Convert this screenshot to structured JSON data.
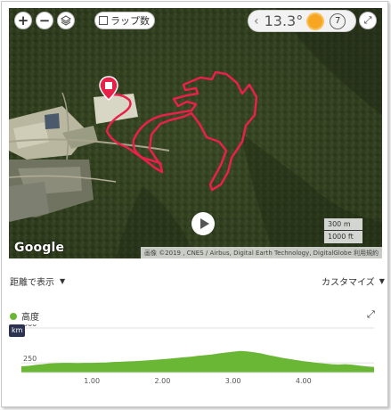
{
  "map": {
    "zoom_in": "+",
    "zoom_out": "−",
    "layers_icon": "layers-icon",
    "lap_label": "ラップ数",
    "weather": {
      "temperature": "13.3°",
      "wind": "7",
      "sun_color": "#f6a623"
    },
    "scale": {
      "metric": "300 m",
      "imperial": "1000 ft"
    },
    "google_logo": "Google",
    "attribution": "画像 ©2019 , CNES / Airbus, Digital Earth Technology, DigitalGlobe",
    "terms": "利用規約",
    "route_color": "#e8214a"
  },
  "controls": {
    "display_mode": "距離で表示",
    "customize": "カスタマイズ"
  },
  "chart_data": {
    "type": "area",
    "series": [
      {
        "name": "高度",
        "color": "#6ab735",
        "x": [
          0,
          0.1,
          0.2,
          0.3,
          0.4,
          0.5,
          0.6,
          0.7,
          0.8,
          0.9,
          1.0,
          1.1,
          1.2,
          1.3,
          1.4,
          1.5,
          1.6,
          1.7,
          1.8,
          1.9,
          2.0,
          2.1,
          2.2,
          2.3,
          2.4,
          2.5,
          2.6,
          2.7,
          2.8,
          2.9,
          3.0,
          3.1,
          3.2,
          3.3,
          3.4,
          3.5,
          3.6,
          3.7,
          3.8,
          3.9,
          4.0,
          4.1,
          4.2,
          4.3,
          4.4,
          4.5,
          4.6,
          4.7,
          4.8,
          4.9,
          5.0
        ],
        "y": [
          225,
          228,
          235,
          240,
          246,
          248,
          250,
          250,
          248,
          250,
          250,
          251,
          252,
          256,
          258,
          260,
          262,
          265,
          268,
          272,
          276,
          280,
          285,
          290,
          294,
          300,
          305,
          310,
          318,
          324,
          330,
          335,
          332,
          326,
          318,
          306,
          296,
          286,
          278,
          270,
          262,
          256,
          250,
          245,
          240,
          238,
          240,
          236,
          230,
          224,
          220
        ]
      }
    ],
    "unit": "km",
    "xticks": [
      "1.00",
      "2.00",
      "3.00",
      "4.00"
    ],
    "xtick_values": [
      1,
      2,
      3,
      4
    ],
    "yticks": [
      "250",
      "500"
    ],
    "ytick_values": [
      250,
      500
    ],
    "xlim": [
      0,
      5.0
    ],
    "ylim": [
      180,
      500
    ]
  }
}
